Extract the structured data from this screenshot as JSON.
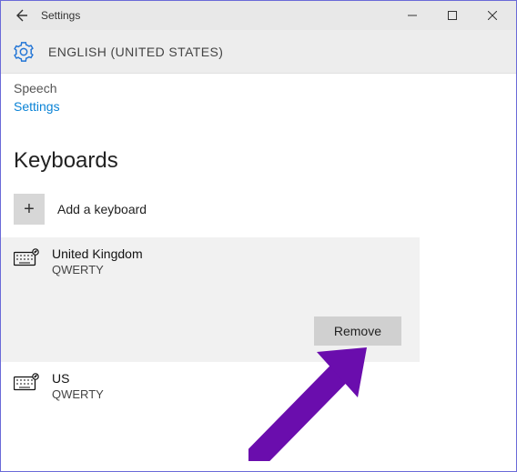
{
  "window": {
    "title": "Settings"
  },
  "language_header": {
    "title": "ENGLISH (UNITED STATES)"
  },
  "topnav": {
    "speech": "Speech",
    "settings": "Settings"
  },
  "section": {
    "keyboards_heading": "Keyboards"
  },
  "add": {
    "label": "Add a keyboard"
  },
  "keyboards": [
    {
      "name": "United Kingdom",
      "layout": "QWERTY",
      "selected": true
    },
    {
      "name": "US",
      "layout": "QWERTY",
      "selected": false
    }
  ],
  "actions": {
    "remove_label": "Remove"
  }
}
